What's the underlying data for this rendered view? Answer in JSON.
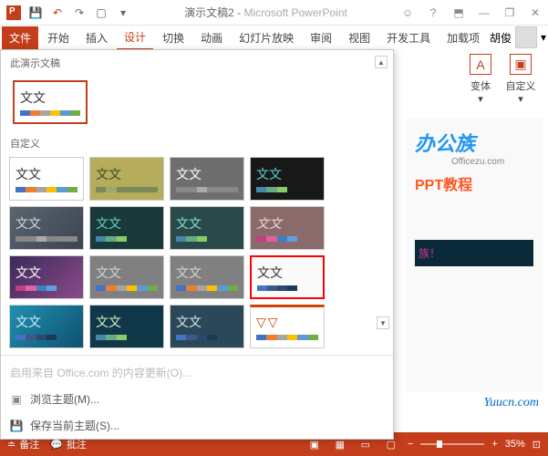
{
  "window": {
    "title_doc": "演示文稿2",
    "title_app": "Microsoft PowerPoint",
    "title_sep": " - "
  },
  "tabs": {
    "file": "文件",
    "home": "开始",
    "insert": "插入",
    "design": "设计",
    "transitions": "切换",
    "animations": "动画",
    "slideshow": "幻灯片放映",
    "review": "审阅",
    "view": "视图",
    "developer": "开发工具",
    "addins": "加载项",
    "account": "胡俊"
  },
  "ribbon_group": {
    "variants": "变体",
    "customize": "自定义"
  },
  "themes_panel": {
    "section_this": "此演示文稿",
    "section_custom": "自定义",
    "theme_label": "文文",
    "theme_label_alt": "文文",
    "footer_office": "启用来自 Office.com 的内容更新(O)...",
    "footer_browse": "浏览主题(M)...",
    "footer_save": "保存当前主题(S)..."
  },
  "slide": {
    "watermark_main": "办公族",
    "watermark_sub": "Officezu.com",
    "watermark2": "PPT教程",
    "band_text": "族！",
    "yuucn": "Yuucn.com"
  },
  "statusbar": {
    "notes": "备注",
    "comments": "批注",
    "zoom_minus": "−",
    "zoom_plus": "+",
    "zoom_value": "35%",
    "fit": "⊡"
  }
}
